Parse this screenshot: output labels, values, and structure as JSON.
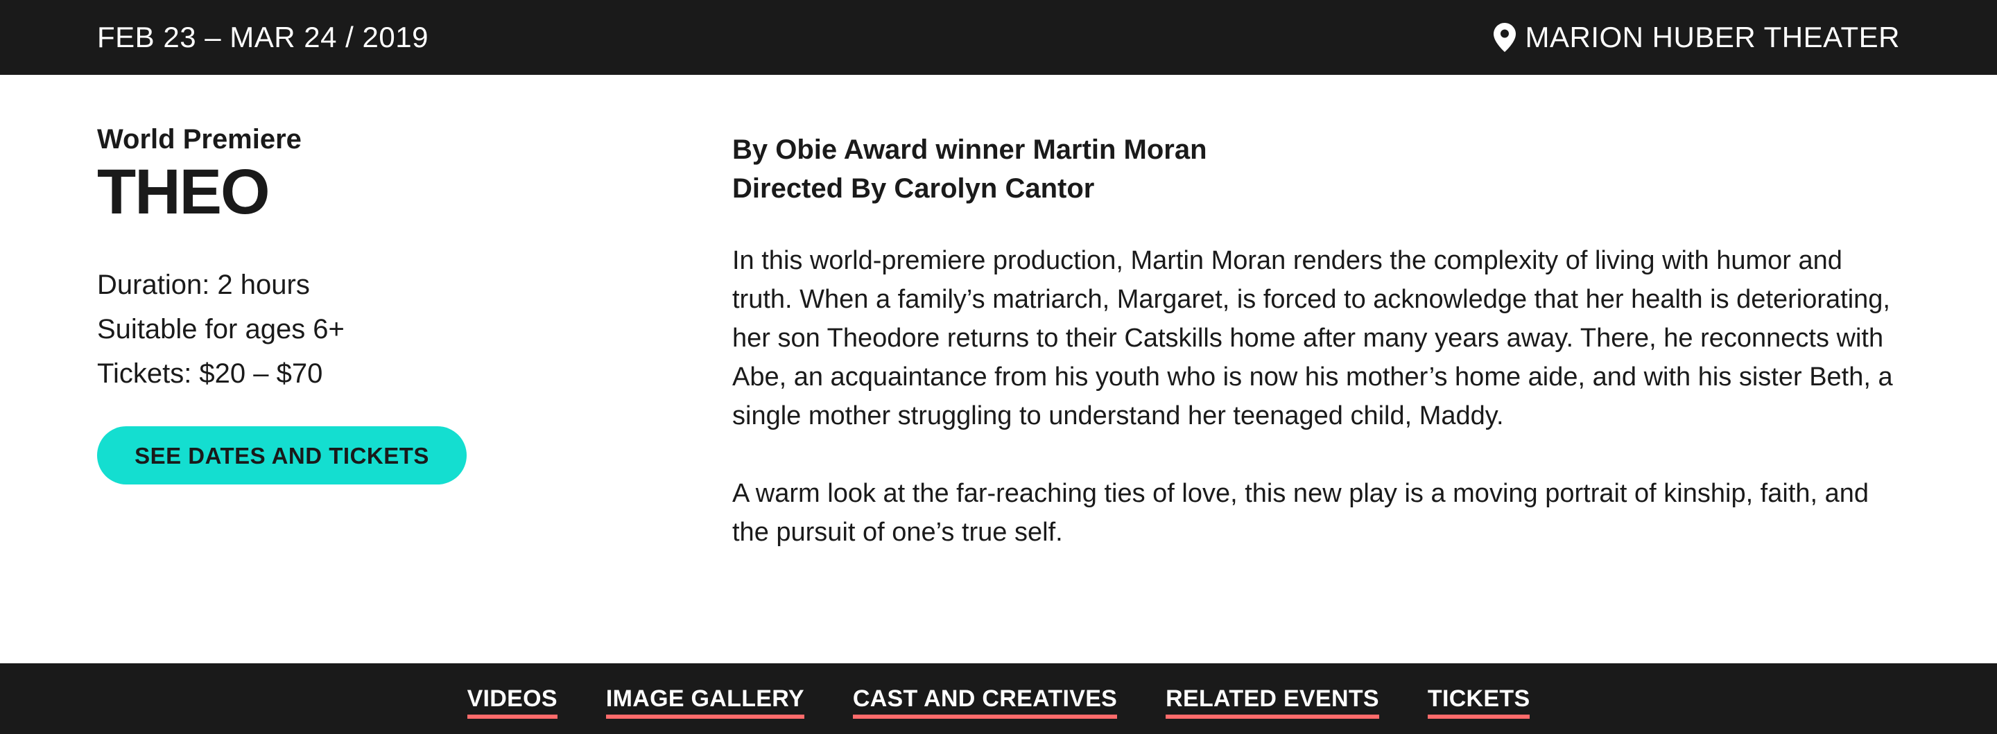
{
  "top_bar": {
    "dates": "FEB 23 – MAR 24 / 2019",
    "venue": "MARION HUBER THEATER",
    "venue_icon": "map-pin-icon"
  },
  "show": {
    "kicker": "World Premiere",
    "title": "THEO",
    "facts": [
      "Duration: 2 hours",
      "Suitable for ages 6+",
      "Tickets: $20 – $70"
    ],
    "cta_label": "SEE DATES AND TICKETS"
  },
  "details": {
    "credit_author": "By Obie Award winner Martin Moran",
    "credit_director": "Directed By Carolyn Cantor",
    "paragraphs": [
      "In this world-premiere production, Martin Moran renders the complexity of living with humor and truth. When a family’s matriarch, Margaret, is forced to acknowledge that her health is deteriorating, her son Theodore returns to their Catskills home after many years away. There, he reconnects with Abe, an acquaintance from his youth who is now his mother’s home aide, and with his sister Beth, a single mother struggling to understand her teenaged child, Maddy.",
      "A warm look at the far-reaching ties of love, this new play is a moving portrait of kinship, faith, and the pursuit of one’s true self."
    ]
  },
  "bottom_nav": {
    "items": [
      "VIDEOS",
      "IMAGE GALLERY",
      "CAST AND CREATIVES",
      "RELATED EVENTS",
      "TICKETS"
    ]
  },
  "colors": {
    "bar_background": "#1a1a1a",
    "cta_accent": "#14ded0",
    "nav_underline": "#ff6b6b"
  }
}
